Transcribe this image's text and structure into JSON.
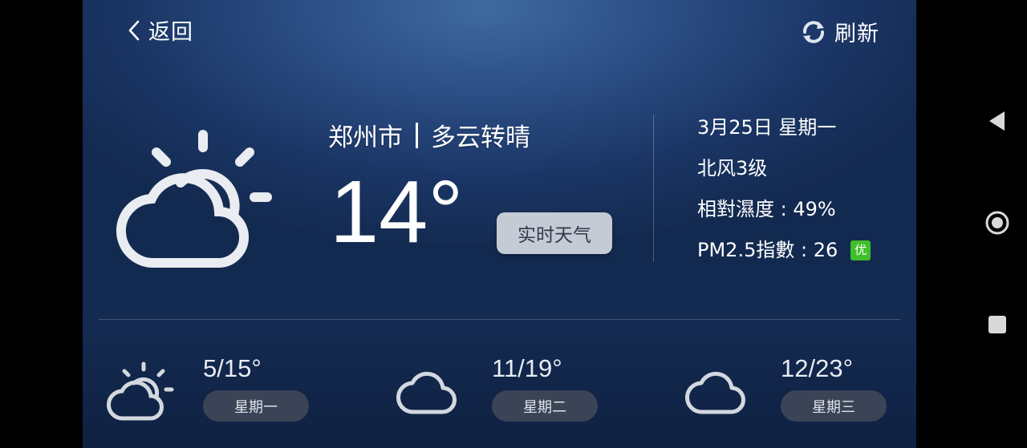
{
  "header": {
    "back_label": "返回",
    "refresh_label": "刷新"
  },
  "current": {
    "city": "郑州市",
    "condition": "多云转晴",
    "temperature": "14°",
    "realtime_label": "实时天气",
    "icon": "partly-sunny-icon"
  },
  "details": {
    "date": "3月25日  星期一",
    "wind": "北风3级",
    "humidity": "相對濕度 : 49%",
    "pm25": "PM2.5指數 : 26",
    "aqi_badge": "优",
    "aqi_color": "#3fbf2a"
  },
  "forecast": [
    {
      "temp": "5/15°",
      "day": "星期一",
      "icon": "partly-sunny-icon"
    },
    {
      "temp": "11/19°",
      "day": "星期二",
      "icon": "cloud-icon"
    },
    {
      "temp": "12/23°",
      "day": "星期三",
      "icon": "cloud-icon"
    }
  ],
  "system_nav": [
    "back-triangle-icon",
    "home-circle-icon",
    "recents-square-icon"
  ]
}
